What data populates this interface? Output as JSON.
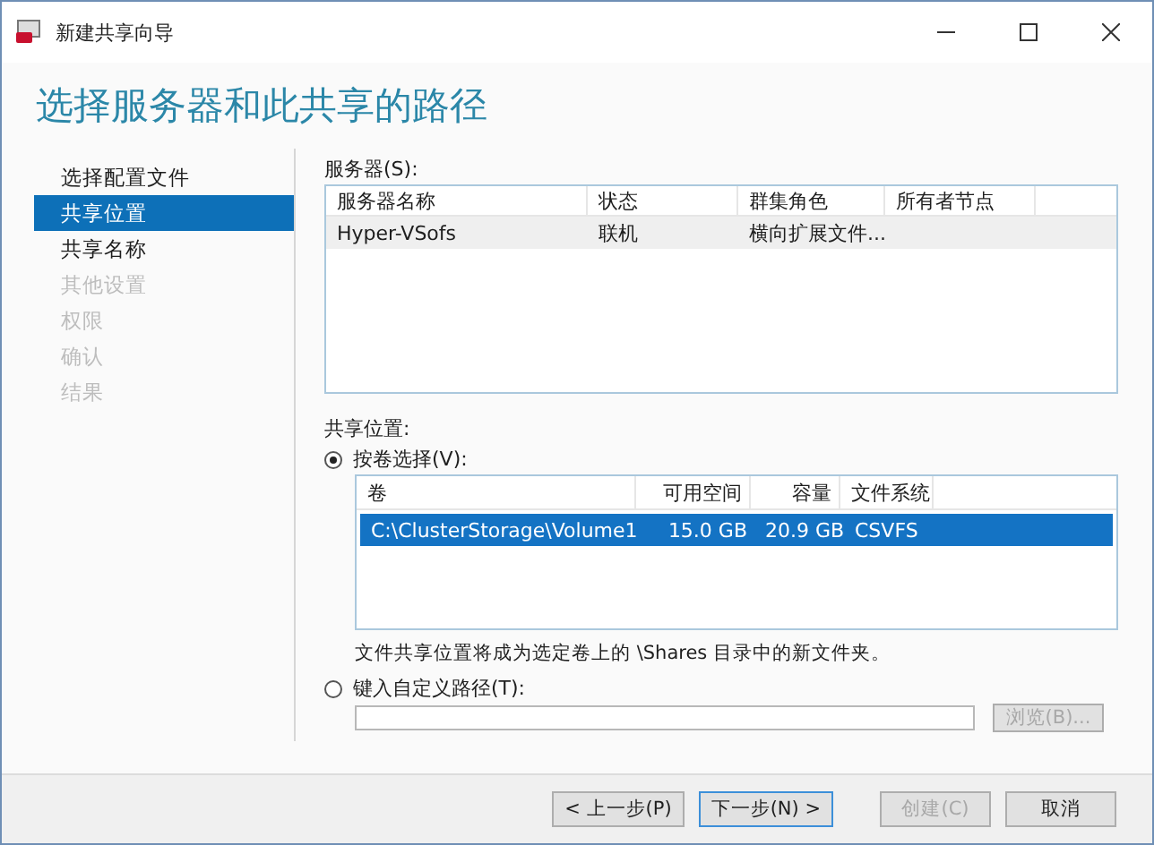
{
  "window": {
    "title": "新建共享向导"
  },
  "heading": "选择服务器和此共享的路径",
  "steps": [
    {
      "label": "选择配置文件",
      "selected": false,
      "disabled": false
    },
    {
      "label": "共享位置",
      "selected": true,
      "disabled": false
    },
    {
      "label": "共享名称",
      "selected": false,
      "disabled": false
    },
    {
      "label": "其他设置",
      "selected": false,
      "disabled": true
    },
    {
      "label": "权限",
      "selected": false,
      "disabled": true
    },
    {
      "label": "确认",
      "selected": false,
      "disabled": true
    },
    {
      "label": "结果",
      "selected": false,
      "disabled": true
    }
  ],
  "servers": {
    "label": "服务器(S):",
    "columns": [
      "服务器名称",
      "状态",
      "群集角色",
      "所有者节点"
    ],
    "rows": [
      {
        "cells": [
          "Hyper-VSofs",
          "联机",
          "横向扩展文件...",
          ""
        ],
        "selected": false
      }
    ]
  },
  "share_location": {
    "label": "共享位置:",
    "by_volume": {
      "label": "按卷选择(V):",
      "selected": true
    },
    "volumes": {
      "columns": [
        "卷",
        "可用空间",
        "容量",
        "文件系统"
      ],
      "rows": [
        {
          "cells": [
            "C:\\ClusterStorage\\Volume1",
            "15.0 GB",
            "20.9 GB",
            "CSVFS"
          ],
          "selected": true
        }
      ]
    },
    "note": "文件共享位置将成为选定卷上的 \\Shares 目录中的新文件夹。",
    "custom_path": {
      "label": "键入自定义路径(T):",
      "selected": false
    },
    "browse": {
      "label": "浏览(B)...",
      "disabled": true
    }
  },
  "buttons": [
    {
      "label": "< 上一步(P)",
      "disabled": false,
      "default": false
    },
    {
      "label": "下一步(N) >",
      "disabled": false,
      "default": true
    },
    {
      "label": "创建(C)",
      "disabled": true,
      "default": false
    },
    {
      "label": "取消",
      "disabled": false,
      "default": false
    }
  ]
}
